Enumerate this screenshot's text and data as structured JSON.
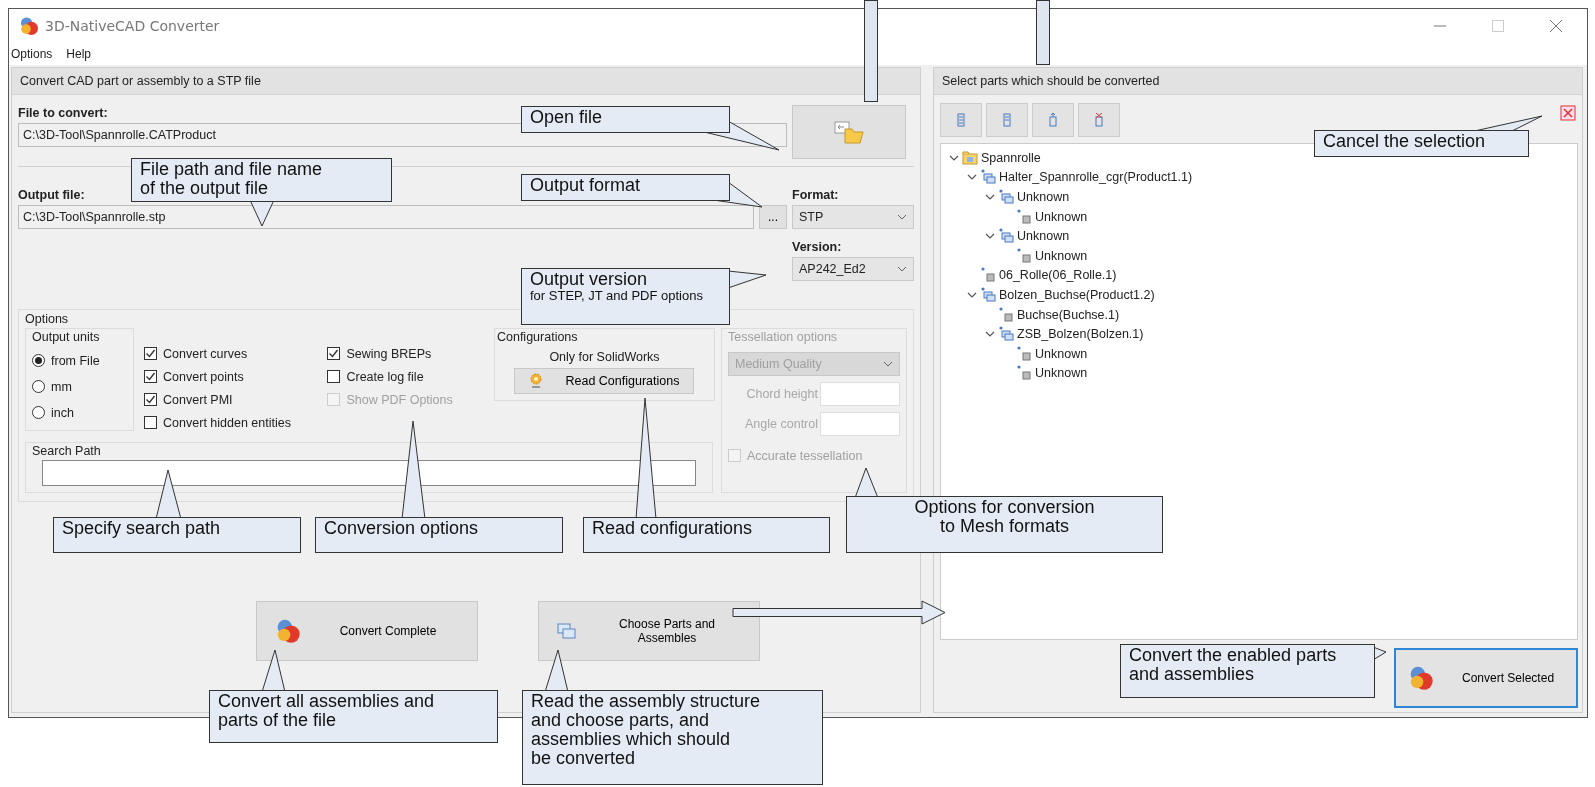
{
  "window": {
    "title": "3D-NativeCAD Converter"
  },
  "menu": [
    {
      "label": "Options"
    },
    {
      "label": "Help"
    }
  ],
  "left_panel": {
    "header": "Convert CAD part or assembly to a STP file",
    "file_label": "File to convert:",
    "file_value": "C:\\3D-Tool\\Spannrolle.CATProduct",
    "output_label": "Output file:",
    "output_value": "C:\\3D-Tool\\Spannrolle.stp",
    "browse_button": "...",
    "format_label": "Format:",
    "format_value": "STP",
    "version_label": "Version:",
    "version_value": "AP242_Ed2",
    "options": {
      "title": "Options",
      "units": {
        "title": "Output units",
        "items": [
          {
            "label": "from File",
            "selected": true
          },
          {
            "label": "mm",
            "selected": false
          },
          {
            "label": "inch",
            "selected": false
          }
        ]
      },
      "checks": [
        {
          "label": "Convert curves",
          "checked": true,
          "disabled": false
        },
        {
          "label": "Convert points",
          "checked": true,
          "disabled": false
        },
        {
          "label": "Convert PMI",
          "checked": true,
          "disabled": false
        },
        {
          "label": "Convert hidden entities",
          "checked": false,
          "disabled": false
        },
        {
          "label": "Sewing BREPs",
          "checked": true,
          "disabled": false
        },
        {
          "label": "Create log file",
          "checked": false,
          "disabled": false
        },
        {
          "label": "Show PDF Options",
          "checked": false,
          "disabled": true
        }
      ],
      "configurations": {
        "title": "Configurations",
        "note": "Only for SolidWorks",
        "button": "Read Configurations"
      },
      "tessellation": {
        "title": "Tessellation options",
        "disabled": true,
        "quality": "Medium Quality",
        "fields": [
          {
            "label": "Chord height"
          },
          {
            "label": "Angle control"
          }
        ],
        "accurate": {
          "label": "Accurate tessellation",
          "checked": false
        }
      },
      "search_path": {
        "title": "Search Path"
      }
    },
    "buttons": [
      {
        "label": "Convert Complete",
        "kind": "convert"
      },
      {
        "label": "Choose Parts and\nAssembles",
        "kind": "choose"
      }
    ]
  },
  "right_panel": {
    "header": "Select parts which should be converted",
    "tree": [
      {
        "label": "Spannrolle",
        "kind": "folder",
        "expanded": true,
        "children": [
          {
            "label": "Halter_Spannrolle_cgr(Product1.1)",
            "kind": "assembly",
            "expanded": true,
            "children": [
              {
                "label": "Unknown",
                "kind": "assembly",
                "expanded": true,
                "children": [
                  {
                    "label": "Unknown",
                    "kind": "part"
                  }
                ]
              },
              {
                "label": "Unknown",
                "kind": "assembly",
                "expanded": true,
                "children": [
                  {
                    "label": "Unknown",
                    "kind": "part"
                  }
                ]
              }
            ]
          },
          {
            "label": "06_Rolle(06_Rolle.1)",
            "kind": "part"
          },
          {
            "label": "Bolzen_Buchse(Product1.2)",
            "kind": "assembly",
            "expanded": true,
            "children": [
              {
                "label": "Buchse(Buchse.1)",
                "kind": "part"
              },
              {
                "label": "ZSB_Bolzen(Bolzen.1)",
                "kind": "assembly",
                "expanded": true,
                "children": [
                  {
                    "label": "Unknown",
                    "kind": "part"
                  },
                  {
                    "label": "Unknown",
                    "kind": "part"
                  }
                ]
              }
            ]
          }
        ]
      }
    ],
    "convert_button": "Convert Selected"
  },
  "callouts": [
    {
      "text": "Open file"
    },
    {
      "text": "File path and file name\nof the output file"
    },
    {
      "text": "Output format"
    },
    {
      "text": "Output version",
      "note": "for STEP, JT and PDF options"
    },
    {
      "text": "Cancel the selection"
    },
    {
      "text": "Specify search path"
    },
    {
      "text": "Conversion options"
    },
    {
      "text": "Read configurations"
    },
    {
      "text": "Options for conversion\nto Mesh formats"
    },
    {
      "text": "Convert all assemblies and\nparts of the file"
    },
    {
      "text": "Read the assembly structure\nand choose parts, and\nassemblies which should\nbe converted"
    },
    {
      "text": "Convert the enabled parts\nand assemblies"
    }
  ]
}
